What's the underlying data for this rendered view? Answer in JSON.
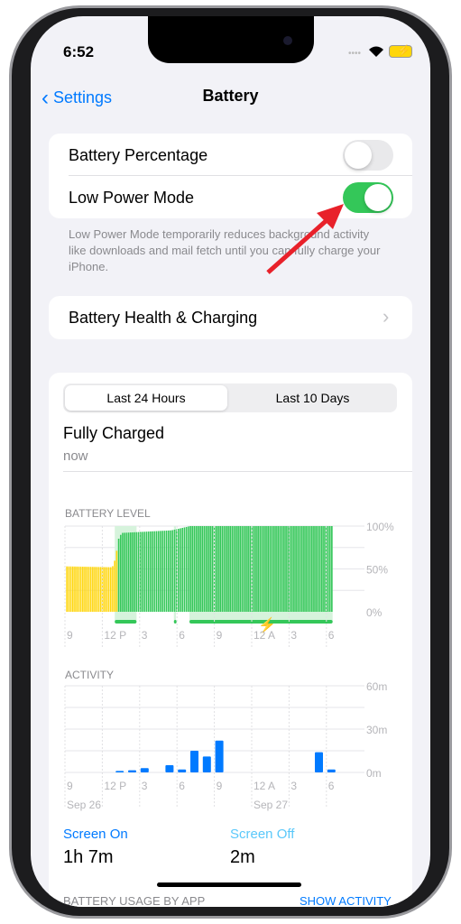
{
  "status_bar": {
    "time": "6:52",
    "icons": [
      "dots-icon",
      "wifi-icon",
      "battery-charging-icon"
    ]
  },
  "nav": {
    "back_label": "Settings",
    "title": "Battery"
  },
  "toggles": [
    {
      "label": "Battery Percentage",
      "on": false
    },
    {
      "label": "Low Power Mode",
      "on": true
    }
  ],
  "low_power_note": "Low Power Mode temporarily reduces background activity like downloads and mail fetch until you can fully charge your iPhone.",
  "health_row": {
    "label": "Battery Health & Charging"
  },
  "segment": {
    "options": [
      "Last 24 Hours",
      "Last 10 Days"
    ],
    "selected": 0
  },
  "charge_status": {
    "title": "Fully Charged",
    "subtitle": "now"
  },
  "colors": {
    "accent": "#007aff",
    "green": "#34c759",
    "yellow": "#ffd60a",
    "toggle_on": "#34c759",
    "arrow": "#e8212a"
  },
  "chart_data": [
    {
      "type": "bar",
      "title": "BATTERY LEVEL",
      "x_tick_labels": [
        "9",
        "12 P",
        "3",
        "6",
        "9",
        "12 A",
        "3",
        "6"
      ],
      "y_tick_labels": [
        "100%",
        "50%",
        "0%"
      ],
      "ylim": [
        0,
        100
      ],
      "points": [
        [
          "9:00 AM",
          53
        ],
        [
          "12:45 PM",
          52
        ],
        [
          "1:00 PM",
          62
        ],
        [
          "1:15 PM",
          85
        ],
        [
          "1:30 PM",
          92
        ],
        [
          "5:30 PM",
          95
        ],
        [
          "7:00 PM",
          100
        ],
        [
          "6:30 AM",
          100
        ]
      ],
      "low_power_until": "1:15 PM",
      "charging_periods": [
        [
          "1:00 PM",
          "2:45 PM"
        ],
        [
          "5:45 PM",
          "5:55 PM"
        ],
        [
          "7:00 PM",
          "6:30 AM"
        ]
      ],
      "grid": true
    },
    {
      "type": "bar",
      "title": "ACTIVITY",
      "x_tick_labels": [
        "9",
        "12 P",
        "3",
        "6",
        "9",
        "12 A",
        "3",
        "6"
      ],
      "date_labels": [
        "Sep 26",
        "Sep 27"
      ],
      "y_tick_labels": [
        "60m",
        "30m",
        "0m"
      ],
      "ylim": [
        0,
        60
      ],
      "categories": [
        "1 PM",
        "2 PM",
        "3 PM",
        "5 PM",
        "6 PM",
        "7 PM",
        "8 PM",
        "9 PM",
        "5 AM",
        "6 AM"
      ],
      "values": [
        1,
        1.5,
        3,
        5,
        2,
        15,
        11,
        22,
        14,
        2
      ],
      "grid": true
    }
  ],
  "usage": {
    "screen_on_label": "Screen On",
    "screen_on_value": "1h 7m",
    "screen_off_label": "Screen Off",
    "screen_off_value": "2m"
  },
  "footer": {
    "section_label": "BATTERY USAGE BY APP",
    "action_label": "SHOW ACTIVITY"
  }
}
